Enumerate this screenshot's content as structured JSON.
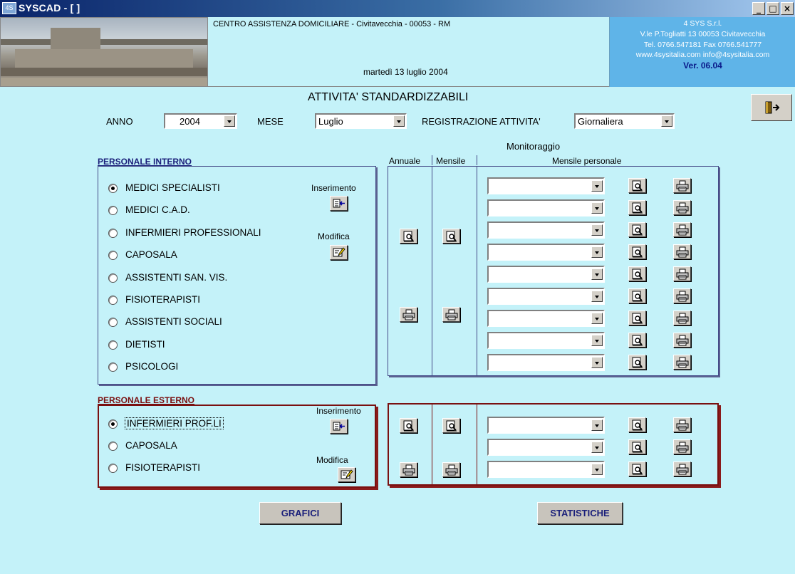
{
  "window": {
    "title": "SYSCAD - [ ]",
    "app_icon": "4S"
  },
  "header": {
    "org_line": "CENTRO ASSISTENZA DOMICILIARE  -  Civitavecchia  -  00053  -  RM",
    "date": "martedì 13 luglio 2004",
    "company": {
      "name": "4 SYS S.r.l.",
      "address": "V.le P.Togliatti 13 00053  Civitavecchia",
      "phone": "Tel. 0766.547181  Fax  0766.541777",
      "web": "www.4sysitalia.com  info@4sysitalia.com",
      "version": "Ver. 06.04"
    }
  },
  "page_title": "ATTIVITA' STANDARDIZZABILI",
  "filters": {
    "anno_label": "ANNO",
    "anno_value": "2004",
    "mese_label": "MESE",
    "mese_value": "Luglio",
    "reg_label": "REGISTRAZIONE ATTIVITA'",
    "reg_value": "Giornaliera"
  },
  "monitor": {
    "heading": "Monitoraggio",
    "col_annuale": "Annuale",
    "col_mensile": "Mensile",
    "col_personale": "Mensile personale"
  },
  "interno": {
    "title": "PERSONALE INTERNO",
    "inserimento_label": "Inserimento",
    "modifica_label": "Modifica",
    "items": [
      {
        "label": "MEDICI SPECIALISTI",
        "selected": true
      },
      {
        "label": "MEDICI C.A.D.",
        "selected": false
      },
      {
        "label": "INFERMIERI PROFESSIONALI",
        "selected": false
      },
      {
        "label": "CAPOSALA",
        "selected": false
      },
      {
        "label": "ASSISTENTI SAN. VIS.",
        "selected": false
      },
      {
        "label": "FISIOTERAPISTI",
        "selected": false
      },
      {
        "label": "ASSISTENTI SOCIALI",
        "selected": false
      },
      {
        "label": "DIETISTI",
        "selected": false
      },
      {
        "label": "PSICOLOGI",
        "selected": false
      }
    ]
  },
  "esterno": {
    "title": "PERSONALE ESTERNO",
    "inserimento_label": "Inserimento",
    "modifica_label": "Modifica",
    "items": [
      {
        "label": "INFERMIERI PROF.LI",
        "selected": true
      },
      {
        "label": "CAPOSALA",
        "selected": false
      },
      {
        "label": "FISIOTERAPISTI",
        "selected": false
      }
    ]
  },
  "buttons": {
    "grafici": "GRAFICI",
    "statistiche": "STATISTICHE"
  },
  "colors": {
    "background": "#c4f2f9",
    "frame_interno": "#444a88",
    "frame_esterno": "#7a1010",
    "company_box": "#5fb4e8"
  }
}
